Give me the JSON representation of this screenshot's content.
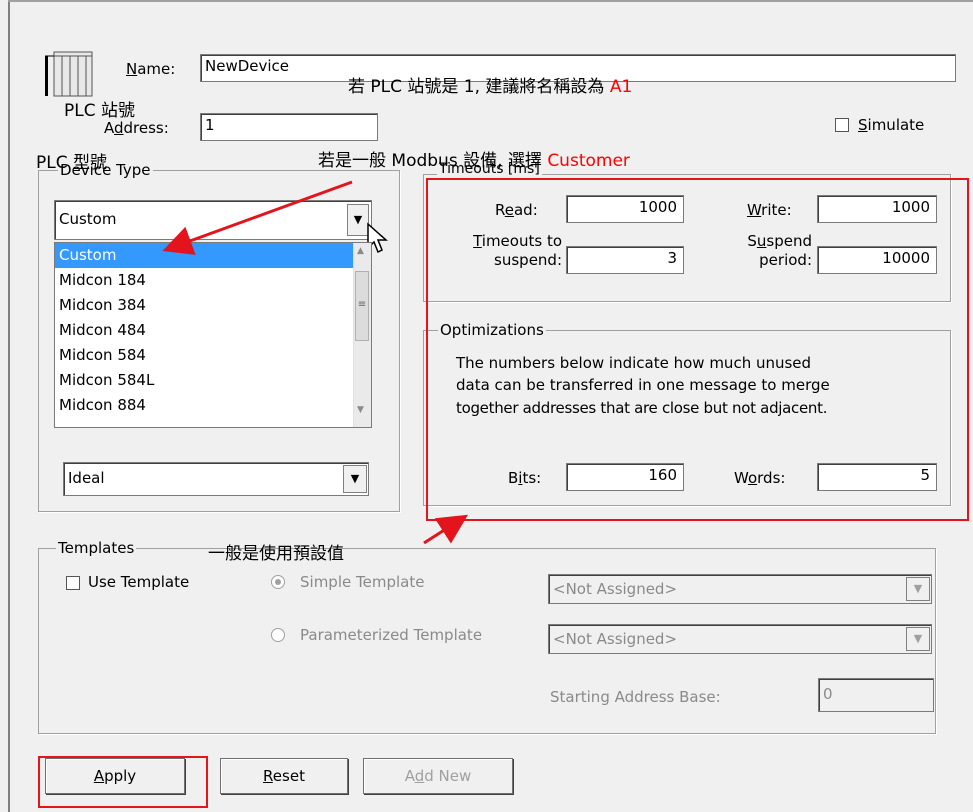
{
  "colors": {
    "accent_red": "#e3141b",
    "selection_blue": "#3399ff"
  },
  "device": {
    "icon": "plc-rack-icon",
    "name_label": "Name:",
    "name_value": "NewDevice",
    "address_label": "Address:",
    "address_value": "1",
    "simulate_label": "Simulate",
    "simulate_checked": false
  },
  "device_type": {
    "title": "Device Type",
    "selected": "Custom",
    "options": [
      "Custom",
      "Midcon 184",
      "Midcon 384",
      "Midcon 484",
      "Midcon 584",
      "Midcon 584L",
      "Midcon 884"
    ],
    "highlighted_index": 0,
    "second_select": "Ideal"
  },
  "timeouts": {
    "title": "Timeouts [ms]",
    "read_label": "Read:",
    "read_value": "1000",
    "write_label": "Write:",
    "write_value": "1000",
    "timeouts_to_label_1": "Timeouts to",
    "timeouts_to_label_2": "suspend:",
    "timeouts_to_value": "3",
    "suspend_label_1": "Suspend",
    "suspend_label_2": "period:",
    "suspend_value": "10000"
  },
  "optimizations": {
    "title": "Optimizations",
    "desc_line1": "The numbers below indicate how much unused",
    "desc_line2": "data can be transferred in one message to merge",
    "desc_line3": "together addresses that are close but not adjacent.",
    "bits_label": "Bits:",
    "bits_value": "160",
    "words_label": "Words:",
    "words_value": "5"
  },
  "templates": {
    "title": "Templates",
    "use_template_label": "Use Template",
    "simple_label": "Simple Template",
    "parameterized_label": "Parameterized Template",
    "simple_select": "<Not Assigned>",
    "param_select": "<Not Assigned>",
    "starting_base_label": "Starting Address Base:",
    "starting_base_value": "0"
  },
  "buttons": {
    "apply": "Apply",
    "reset": "Reset",
    "add_new": "Add New"
  },
  "annotations": {
    "name_tip_prefix": "若 PLC 站號是 1, 建議將名稱設為 ",
    "name_tip_value": "A1",
    "plc_station": "PLC 站號",
    "plc_type": "PLC 型號",
    "modbus_tip_prefix": "若是一般 Modbus 設備, 選擇 ",
    "modbus_tip_value": "Customer",
    "default_tip": "一般是使用預設值"
  }
}
